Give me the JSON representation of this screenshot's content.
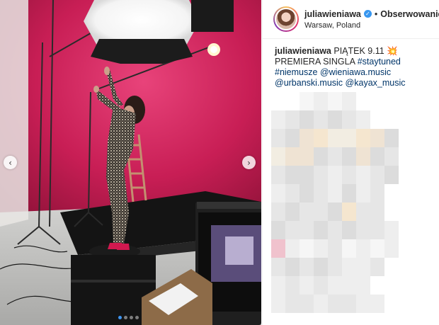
{
  "post": {
    "username": "juliawieniawa",
    "separator": "•",
    "follow_label": "Obserwowanie",
    "location": "Warsaw, Poland",
    "verified_glyph": "✓"
  },
  "caption": {
    "username": "juliawieniawa",
    "text_before": "PIĄTEK 9.11",
    "emoji": "💥",
    "text_after": "PREMIERA SINGLA",
    "hashtags": [
      "#staytuned",
      "#niemusze"
    ],
    "mentions": [
      "@wieniawa.music",
      "@urbanski.music",
      "@kayax_music"
    ]
  },
  "carousel": {
    "prev_glyph": "‹",
    "next_glyph": "›",
    "slide_count": 4,
    "active_index": 0
  },
  "icons": {
    "prev": "chevron-left-icon",
    "next": "chevron-right-icon",
    "verified": "verified-badge-icon"
  },
  "colors": {
    "link": "#003569",
    "accent_blue": "#3897f0",
    "backdrop_magenta": "#c81e55"
  }
}
